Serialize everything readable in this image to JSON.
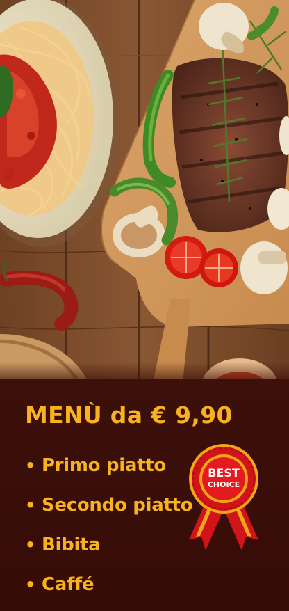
{
  "headline": "MENÙ da € 9,90",
  "items": [
    {
      "label": "Primo piatto"
    },
    {
      "label": "Secondo piatto"
    },
    {
      "label": "Bibita"
    },
    {
      "label": "Caffé"
    }
  ],
  "bullet": "•",
  "badge": {
    "line1": "BEST",
    "line2": "CHOICE"
  },
  "colors": {
    "accent": "#f7b21e",
    "background": "#3d100a",
    "badge_red": "#d0141a",
    "badge_gold": "#f2a516"
  },
  "photo": {
    "subject": "spaghetti-and-steak-on-wooden-table"
  }
}
